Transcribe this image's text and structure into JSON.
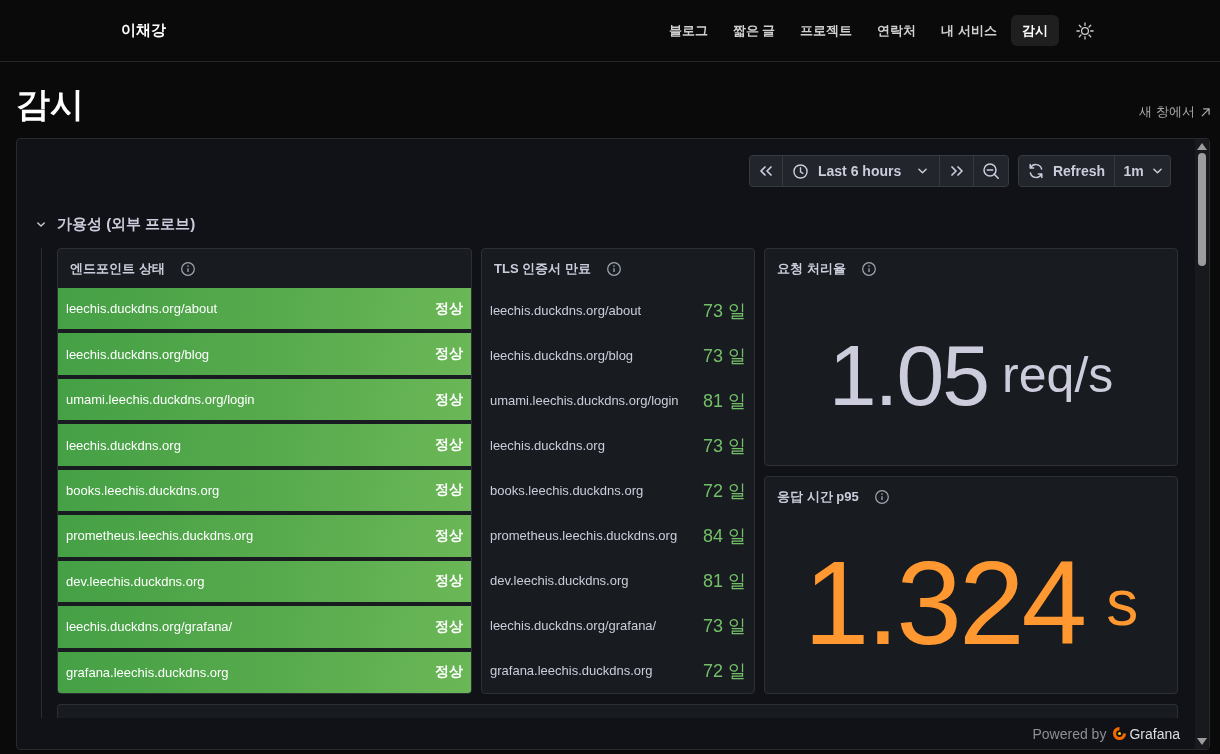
{
  "header": {
    "logo": "이채강",
    "nav": [
      {
        "label": "블로그",
        "selected": false
      },
      {
        "label": "짧은 글",
        "selected": false
      },
      {
        "label": "프로젝트",
        "selected": false
      },
      {
        "label": "연락처",
        "selected": false
      },
      {
        "label": "내 서비스",
        "selected": false
      },
      {
        "label": "감시",
        "selected": true
      }
    ]
  },
  "page": {
    "title": "감시",
    "open_link": "새 창에서"
  },
  "toolbar": {
    "time_range": "Last 6 hours",
    "refresh": "Refresh",
    "interval": "1m"
  },
  "section": {
    "title": "가용성 (외부 프로브)",
    "expanded": true
  },
  "endpoint_panel": {
    "title": "엔드포인트 상태",
    "rows": [
      {
        "url": "leechis.duckdns.org/about",
        "status": "정상"
      },
      {
        "url": "leechis.duckdns.org/blog",
        "status": "정상"
      },
      {
        "url": "umami.leechis.duckdns.org/login",
        "status": "정상"
      },
      {
        "url": "leechis.duckdns.org",
        "status": "정상"
      },
      {
        "url": "books.leechis.duckdns.org",
        "status": "정상"
      },
      {
        "url": "prometheus.leechis.duckdns.org",
        "status": "정상"
      },
      {
        "url": "dev.leechis.duckdns.org",
        "status": "정상"
      },
      {
        "url": "leechis.duckdns.org/grafana/",
        "status": "정상"
      },
      {
        "url": "grafana.leechis.duckdns.org",
        "status": "정상"
      }
    ]
  },
  "tls_panel": {
    "title": "TLS 인증서 만료",
    "rows": [
      {
        "url": "leechis.duckdns.org/about",
        "days": "73 일"
      },
      {
        "url": "leechis.duckdns.org/blog",
        "days": "73 일"
      },
      {
        "url": "umami.leechis.duckdns.org/login",
        "days": "81 일"
      },
      {
        "url": "leechis.duckdns.org",
        "days": "73 일"
      },
      {
        "url": "books.leechis.duckdns.org",
        "days": "72 일"
      },
      {
        "url": "prometheus.leechis.duckdns.org",
        "days": "84 일"
      },
      {
        "url": "dev.leechis.duckdns.org",
        "days": "81 일"
      },
      {
        "url": "leechis.duckdns.org/grafana/",
        "days": "73 일"
      },
      {
        "url": "grafana.leechis.duckdns.org",
        "days": "72 일"
      }
    ]
  },
  "stat_panels": [
    {
      "title": "요청 처리율",
      "value": "1.05",
      "unit": "req/s",
      "color": "#ccccdc"
    },
    {
      "title": "응답 시간 p95",
      "value": "1.324",
      "unit": "s",
      "color": "#ff9830"
    }
  ],
  "footer": {
    "powered_by": "Powered by",
    "brand": "Grafana"
  }
}
